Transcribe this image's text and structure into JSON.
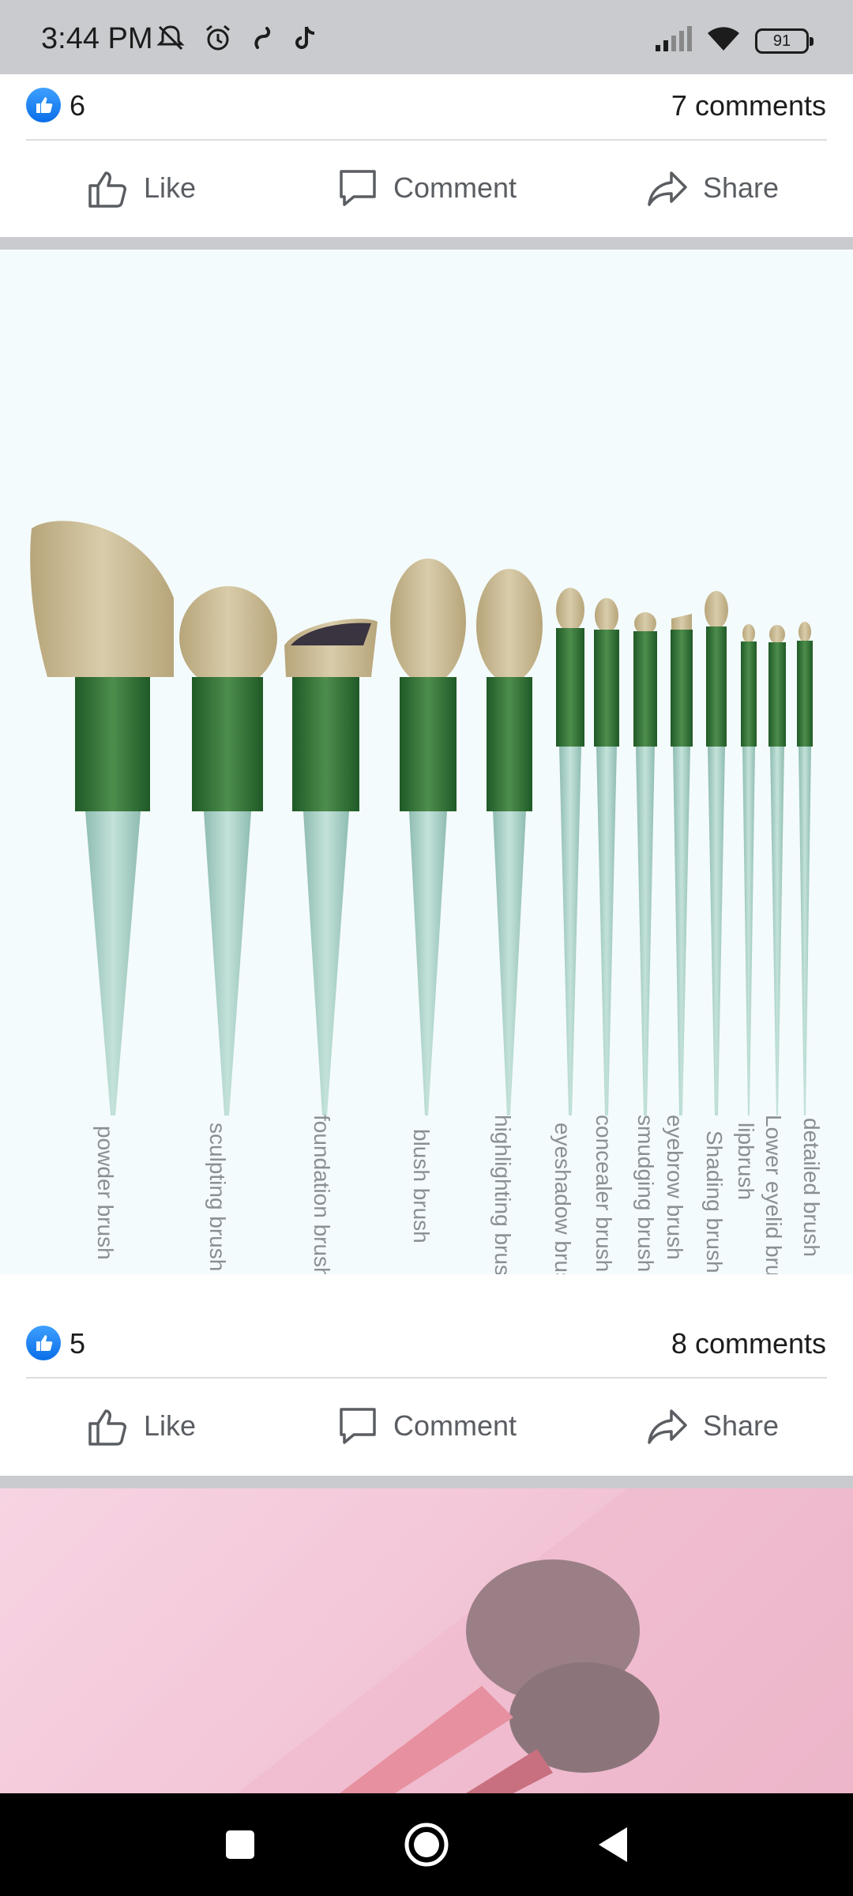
{
  "status_bar": {
    "time": "3:44 PM",
    "battery": "91"
  },
  "posts": [
    {
      "likes": "6",
      "comments": "7 comments",
      "actions": {
        "like": "Like",
        "comment": "Comment",
        "share": "Share"
      }
    },
    {
      "likes": "5",
      "comments": "8 comments",
      "actions": {
        "like": "Like",
        "comment": "Comment",
        "share": "Share"
      },
      "image_labels": [
        "powder brush",
        "sculpting brush",
        "foundation brush",
        "blush brush",
        "highlighting brush",
        "eyeshadow brush",
        "concealer brush",
        "smudging brush",
        "eyebrow brush",
        "Shading brush",
        "lipbrush",
        "Lower eyelid brush",
        "detailed brush"
      ]
    }
  ],
  "colors": {
    "brand_blue": "#1877f2",
    "brush_green": "#2f6b35",
    "handle_mint": "#a9cfc6",
    "bristle": "#c8b98f"
  }
}
